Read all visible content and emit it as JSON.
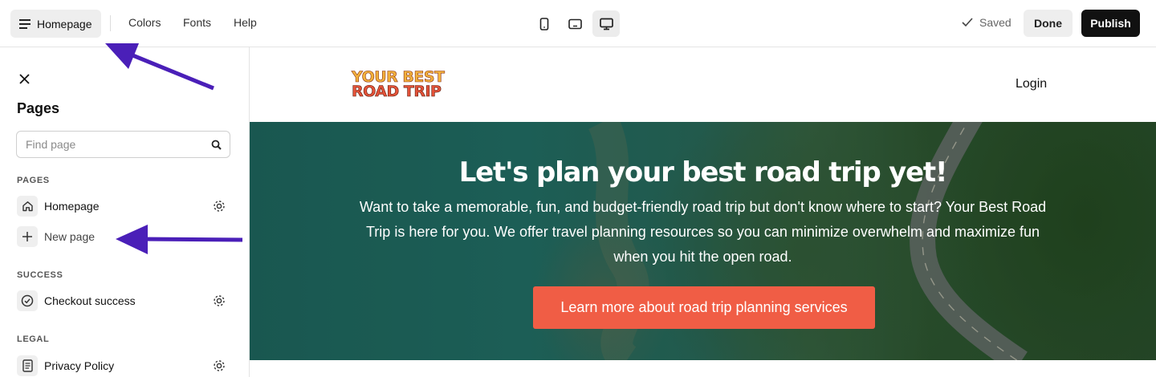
{
  "topbar": {
    "page_button": "Homepage",
    "links": [
      "Colors",
      "Fonts",
      "Help"
    ],
    "devices": [
      "mobile-icon",
      "tablet-icon",
      "desktop-icon"
    ],
    "saved": "Saved",
    "done": "Done",
    "publish": "Publish"
  },
  "sidebar": {
    "title": "Pages",
    "search_placeholder": "Find page",
    "sections": {
      "pages": "PAGES",
      "success": "SUCCESS",
      "legal": "LEGAL"
    },
    "items": {
      "homepage": "Homepage",
      "new_page": "New page",
      "checkout_success": "Checkout success",
      "privacy_policy": "Privacy Policy"
    }
  },
  "preview": {
    "logo_line1": "YOUR BEST",
    "logo_line2": "ROAD TRIP",
    "login": "Login",
    "hero_title": "Let's plan your best road trip yet!",
    "hero_text": "Want to take a memorable, fun, and budget-friendly road trip but don't know where to start? Your Best Road Trip is here for you. We offer travel planning resources so you can minimize overwhelm and maximize fun when you hit the open road.",
    "cta": "Learn more about road trip planning services"
  },
  "colors": {
    "publish_bg": "#111111",
    "cta": "#f05d45",
    "annotation_arrow": "#4a1fb8"
  }
}
